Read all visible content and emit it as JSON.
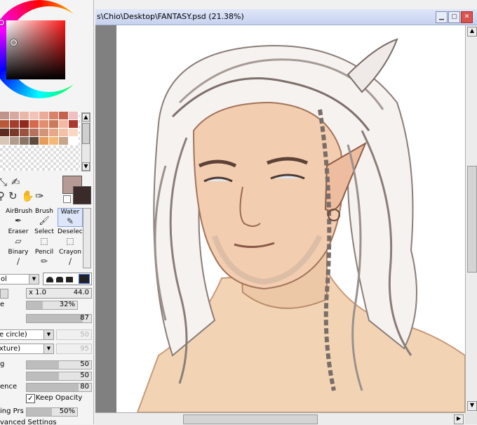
{
  "window": {
    "title": "s\\Chio\\Desktop\\FANTASY.psd (21.38%)",
    "buttons": {
      "minimize": "▁",
      "maximize": "▢",
      "close": "✕"
    }
  },
  "palette": {
    "swatches": [
      "#c0938c",
      "#d7a8a0",
      "#e7b7a8",
      "#f0c3b6",
      "#ebab99",
      "#d9826a",
      "#c4614f",
      "#f0c0c0",
      "#b75a3c",
      "#a23e2d",
      "#8e2a1e",
      "#d4694e",
      "#e0906e",
      "#c97c5c",
      "#f2b9a4",
      "#a83a30",
      "#5e2b22",
      "#7a3a2a",
      "#9b5240",
      "#b5735d",
      "#d39578",
      "#e5a98a",
      "#f3c1a7",
      "#fad7c3",
      "#d8c7b7",
      "#b29c8c",
      "#8a7564",
      "#5d4b3f",
      "#e89c5a",
      "#f3b877",
      "#c7a48a",
      "#fff"
    ],
    "foreground": "#b79a93",
    "background": "#3b2a2a"
  },
  "brushes": [
    {
      "label": "AirBrush",
      "icon": "✒",
      "active": false
    },
    {
      "label": "Brush",
      "icon": "🖌",
      "active": false
    },
    {
      "label": "Water",
      "icon": "✎",
      "active": true
    },
    {
      "label": "Eraser",
      "icon": "▱",
      "active": false
    },
    {
      "label": "Select",
      "icon": "⬚",
      "active": false
    },
    {
      "label": "Deselect",
      "icon": "⬚",
      "active": false
    },
    {
      "label": "Binary",
      "icon": "∕",
      "active": false
    },
    {
      "label": "Pencil",
      "icon": "✏",
      "active": false
    },
    {
      "label": "Crayon",
      "icon": "∕",
      "active": false
    }
  ],
  "settings": {
    "blend_mode": "ol",
    "size_multiplier": "x 1.0",
    "size_value": "44.0",
    "density_label": "e",
    "density_value": "32%",
    "density_fill": 0.32,
    "min_size_value": "87",
    "min_size_fill": 0.87,
    "shape_dropdown": "e circle)",
    "shape_value": "50",
    "texture_dropdown": "xture)",
    "texture_value": "95",
    "blending_label": "g",
    "blending_value": "50",
    "blending_fill": 0.5,
    "dilution_value": "50",
    "dilution_fill": 0.5,
    "persistence_label": "ence",
    "persistence_value": "80",
    "persistence_fill": 0.8,
    "keep_opacity_label": "Keep Opacity",
    "keep_opacity_checked": true,
    "blending_prs_label": "ing Prs",
    "blending_prs_value": "50%",
    "blending_prs_fill": 0.5,
    "advanced_label": "vanced Settings"
  }
}
